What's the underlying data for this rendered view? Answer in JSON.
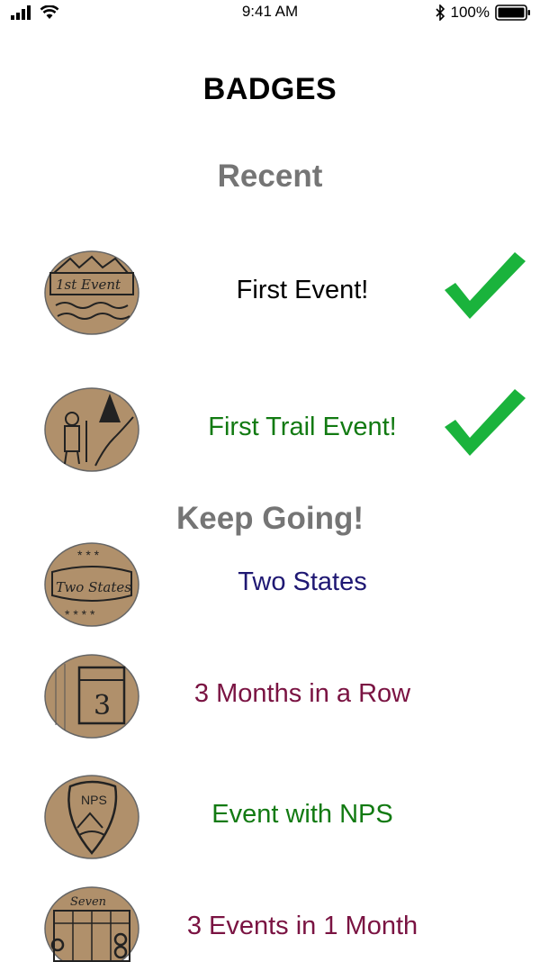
{
  "status_bar": {
    "time": "9:41 AM",
    "battery_pct": "100%"
  },
  "page_title": "BADGES",
  "sections": {
    "recent": "Recent",
    "keep_going": "Keep Going!"
  },
  "badges": [
    {
      "label": "First Event!",
      "color": "#000000",
      "completed": true,
      "art_text": "1st Event"
    },
    {
      "label": "First Trail Event!",
      "color": "#127a12",
      "completed": true,
      "art_text": ""
    },
    {
      "label": "Two States",
      "color": "#1f1873",
      "completed": false,
      "art_text": "Two States"
    },
    {
      "label": "3 Months in a Row",
      "color": "#7a1342",
      "completed": false,
      "art_text": "Months 3"
    },
    {
      "label": "Event with NPS",
      "color": "#127a12",
      "completed": false,
      "art_text": "NPS"
    },
    {
      "label": "3 Events in 1 Month",
      "color": "#7a1342",
      "completed": false,
      "art_text": "Seven"
    }
  ],
  "check_color": "#1ab33c"
}
